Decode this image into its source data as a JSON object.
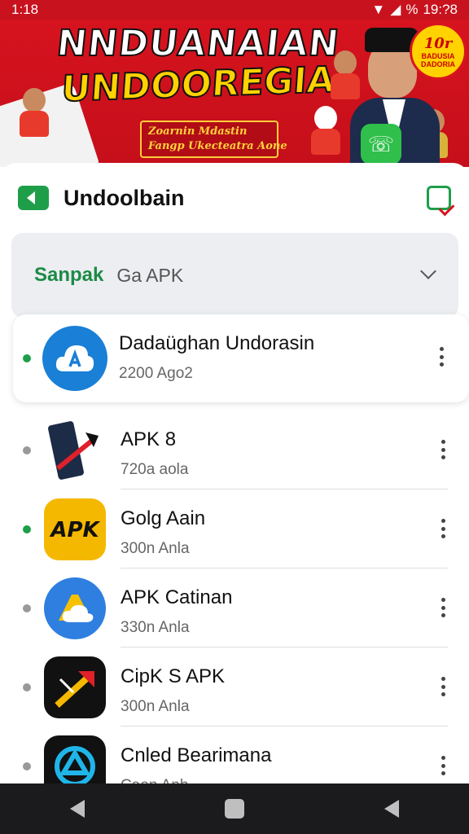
{
  "status_bar": {
    "time": "1:18",
    "right_time": "19:?8",
    "pct": "%"
  },
  "banner": {
    "title_line1": "NNDUANAIAN",
    "title_line2": "UNDOOREGIA!",
    "subtitle_line1": "Zoarnin Mdastin",
    "subtitle_line2": "Fangp Ukecteatra Aone",
    "badge_line1": "10r",
    "badge_line2": "BADUSIA DADORIA"
  },
  "sheet": {
    "title": "Undoolbain",
    "filter": {
      "label": "Sanpak",
      "value": "Ga APK"
    }
  },
  "apps": [
    {
      "name": "Dadaüghan Undorasin",
      "meta": "2200 Ago2",
      "active": true,
      "icon": "cloud-app-icon",
      "selected": true
    },
    {
      "name": "APK 8",
      "meta": "720a aola",
      "active": false,
      "icon": "phone-arrow-icon"
    },
    {
      "name": "Golg Aain",
      "meta": "300n Anla",
      "active": true,
      "icon": "apk-badge-icon"
    },
    {
      "name": "APK Catinan",
      "meta": "330n Anla",
      "active": false,
      "icon": "drive-cloud-icon"
    },
    {
      "name": "CipK S APK",
      "meta": "300n Anla",
      "active": false,
      "icon": "arrow-box-icon"
    },
    {
      "name": "Cnled Bearimana",
      "meta": "Caon Anh",
      "active": false,
      "icon": "triangle-ring-icon"
    }
  ],
  "colors": {
    "banner_red": "#d8141f",
    "accent_green": "#1f9e4a",
    "navbar": "#1b1b1d"
  }
}
